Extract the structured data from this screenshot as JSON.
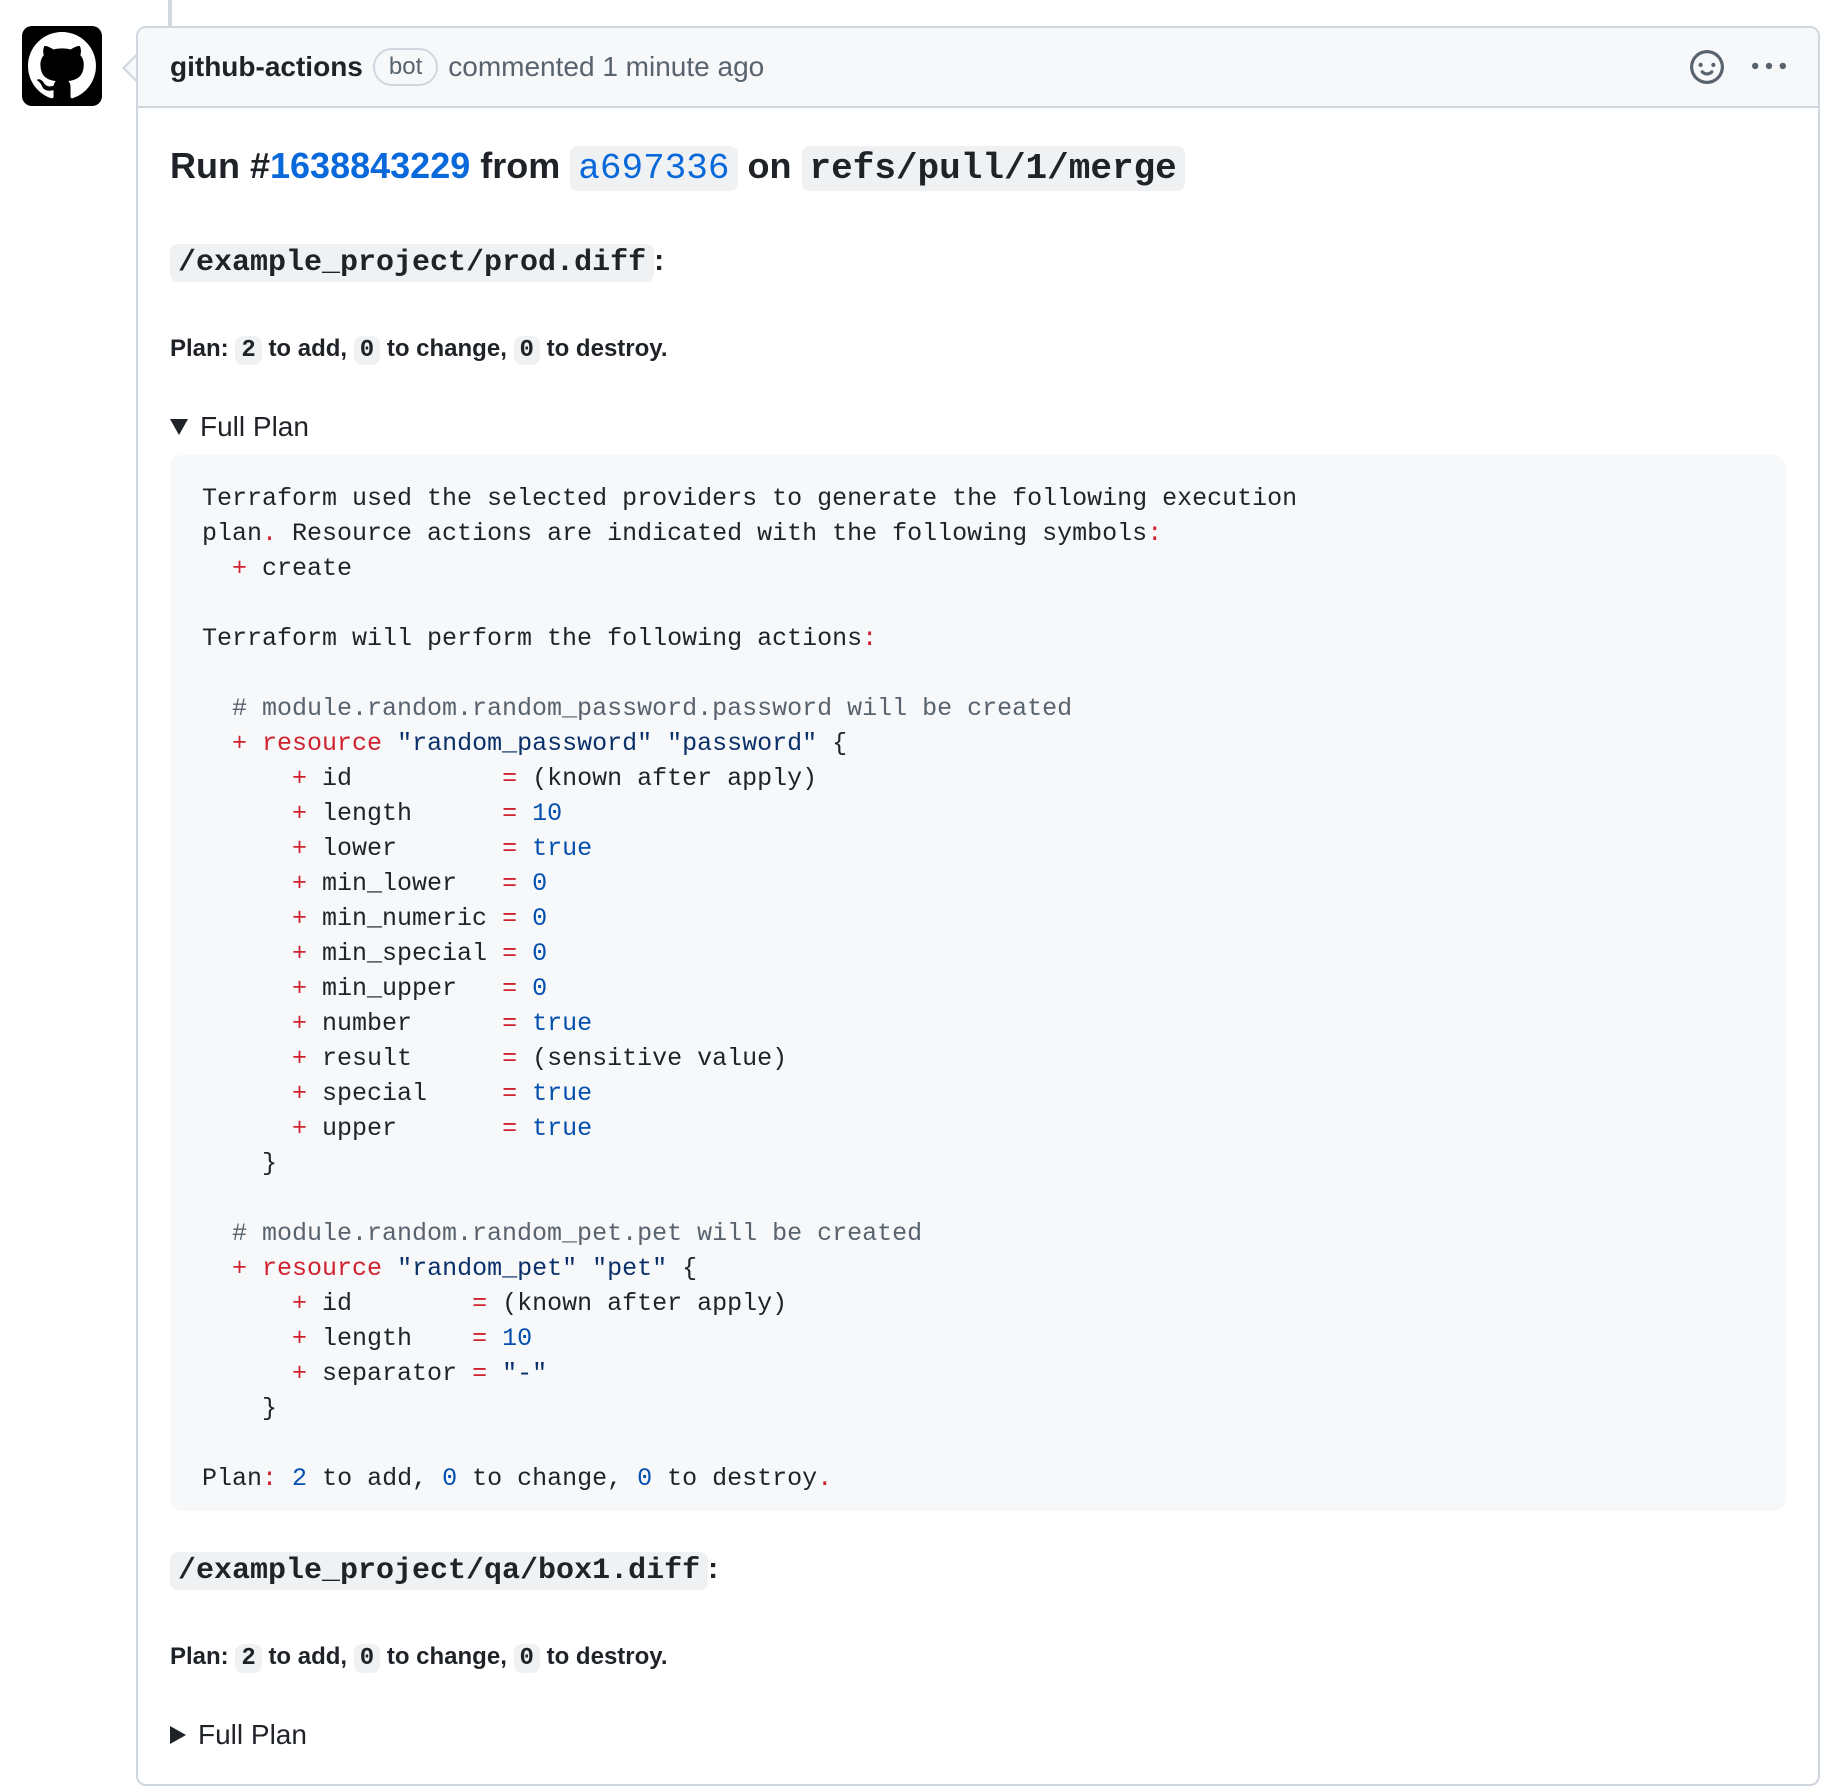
{
  "comment": {
    "author": "github-actions",
    "badge": "bot",
    "action": "commented 1 minute ago",
    "run": {
      "prefix": "Run #",
      "number": "1638843229",
      "from": "from",
      "commit": "a697336",
      "on": "on",
      "ref": "refs/pull/1/merge"
    },
    "sections": [
      {
        "file": "/example_project/prod.diff",
        "plan_prefix": "Plan:",
        "add": "2",
        "add_label": "to add,",
        "change": "0",
        "change_label": "to change,",
        "destroy": "0",
        "destroy_label": "to destroy.",
        "details_label": "Full Plan",
        "expanded": true
      },
      {
        "file": "/example_project/qa/box1.diff",
        "plan_prefix": "Plan:",
        "add": "2",
        "add_label": "to add,",
        "change": "0",
        "change_label": "to change,",
        "destroy": "0",
        "destroy_label": "to destroy.",
        "details_label": "Full Plan",
        "expanded": false
      }
    ],
    "plan_lines": [
      [
        {
          "t": "Terraform used the selected providers to generate the following execution"
        }
      ],
      [
        {
          "t": "plan"
        },
        {
          "t": ".",
          "c": "red"
        },
        {
          "t": " Resource actions are indicated with the following symbols"
        },
        {
          "t": ":",
          "c": "red"
        }
      ],
      [
        {
          "t": "  "
        },
        {
          "t": "+",
          "c": "red"
        },
        {
          "t": " create"
        }
      ],
      [],
      [
        {
          "t": "Terraform will perform the following actions"
        },
        {
          "t": ":",
          "c": "red"
        }
      ],
      [],
      [
        {
          "t": "  # module.random.random_password.password will be created",
          "c": "gray"
        }
      ],
      [
        {
          "t": "  "
        },
        {
          "t": "+ resource",
          "c": "red"
        },
        {
          "t": " "
        },
        {
          "t": "\"random_password\"",
          "c": "navy"
        },
        {
          "t": " "
        },
        {
          "t": "\"password\"",
          "c": "navy"
        },
        {
          "t": " {"
        }
      ],
      [
        {
          "t": "      "
        },
        {
          "t": "+",
          "c": "red"
        },
        {
          "t": " id          "
        },
        {
          "t": "=",
          "c": "red"
        },
        {
          "t": " (known after apply)"
        }
      ],
      [
        {
          "t": "      "
        },
        {
          "t": "+",
          "c": "red"
        },
        {
          "t": " length      "
        },
        {
          "t": "=",
          "c": "red"
        },
        {
          "t": " "
        },
        {
          "t": "10",
          "c": "blue"
        }
      ],
      [
        {
          "t": "      "
        },
        {
          "t": "+",
          "c": "red"
        },
        {
          "t": " lower       "
        },
        {
          "t": "=",
          "c": "red"
        },
        {
          "t": " "
        },
        {
          "t": "true",
          "c": "blue"
        }
      ],
      [
        {
          "t": "      "
        },
        {
          "t": "+",
          "c": "red"
        },
        {
          "t": " min_lower   "
        },
        {
          "t": "=",
          "c": "red"
        },
        {
          "t": " "
        },
        {
          "t": "0",
          "c": "blue"
        }
      ],
      [
        {
          "t": "      "
        },
        {
          "t": "+",
          "c": "red"
        },
        {
          "t": " min_numeric "
        },
        {
          "t": "=",
          "c": "red"
        },
        {
          "t": " "
        },
        {
          "t": "0",
          "c": "blue"
        }
      ],
      [
        {
          "t": "      "
        },
        {
          "t": "+",
          "c": "red"
        },
        {
          "t": " min_special "
        },
        {
          "t": "=",
          "c": "red"
        },
        {
          "t": " "
        },
        {
          "t": "0",
          "c": "blue"
        }
      ],
      [
        {
          "t": "      "
        },
        {
          "t": "+",
          "c": "red"
        },
        {
          "t": " min_upper   "
        },
        {
          "t": "=",
          "c": "red"
        },
        {
          "t": " "
        },
        {
          "t": "0",
          "c": "blue"
        }
      ],
      [
        {
          "t": "      "
        },
        {
          "t": "+",
          "c": "red"
        },
        {
          "t": " number      "
        },
        {
          "t": "=",
          "c": "red"
        },
        {
          "t": " "
        },
        {
          "t": "true",
          "c": "blue"
        }
      ],
      [
        {
          "t": "      "
        },
        {
          "t": "+",
          "c": "red"
        },
        {
          "t": " result      "
        },
        {
          "t": "=",
          "c": "red"
        },
        {
          "t": " (sensitive value)"
        }
      ],
      [
        {
          "t": "      "
        },
        {
          "t": "+",
          "c": "red"
        },
        {
          "t": " special     "
        },
        {
          "t": "=",
          "c": "red"
        },
        {
          "t": " "
        },
        {
          "t": "true",
          "c": "blue"
        }
      ],
      [
        {
          "t": "      "
        },
        {
          "t": "+",
          "c": "red"
        },
        {
          "t": " upper       "
        },
        {
          "t": "=",
          "c": "red"
        },
        {
          "t": " "
        },
        {
          "t": "true",
          "c": "blue"
        }
      ],
      [
        {
          "t": "    }"
        }
      ],
      [],
      [
        {
          "t": "  # module.random.random_pet.pet will be created",
          "c": "gray"
        }
      ],
      [
        {
          "t": "  "
        },
        {
          "t": "+ resource",
          "c": "red"
        },
        {
          "t": " "
        },
        {
          "t": "\"random_pet\"",
          "c": "navy"
        },
        {
          "t": " "
        },
        {
          "t": "\"pet\"",
          "c": "navy"
        },
        {
          "t": " {"
        }
      ],
      [
        {
          "t": "      "
        },
        {
          "t": "+",
          "c": "red"
        },
        {
          "t": " id        "
        },
        {
          "t": "=",
          "c": "red"
        },
        {
          "t": " (known after apply)"
        }
      ],
      [
        {
          "t": "      "
        },
        {
          "t": "+",
          "c": "red"
        },
        {
          "t": " length    "
        },
        {
          "t": "=",
          "c": "red"
        },
        {
          "t": " "
        },
        {
          "t": "10",
          "c": "blue"
        }
      ],
      [
        {
          "t": "      "
        },
        {
          "t": "+",
          "c": "red"
        },
        {
          "t": " separator "
        },
        {
          "t": "=",
          "c": "red"
        },
        {
          "t": " "
        },
        {
          "t": "\"-\"",
          "c": "navy"
        }
      ],
      [
        {
          "t": "    }"
        }
      ],
      [],
      [
        {
          "t": "Plan"
        },
        {
          "t": ":",
          "c": "red"
        },
        {
          "t": " "
        },
        {
          "t": "2",
          "c": "blue"
        },
        {
          "t": " to add, "
        },
        {
          "t": "0",
          "c": "blue"
        },
        {
          "t": " to change, "
        },
        {
          "t": "0",
          "c": "blue"
        },
        {
          "t": " to destroy"
        },
        {
          "t": ".",
          "c": "red"
        }
      ]
    ]
  },
  "icons": {
    "avatar": "github-octocat-icon",
    "reaction": "smiley-icon",
    "menu": "kebab-menu-icon",
    "expanded": "triangle-down-icon",
    "collapsed": "triangle-right-icon"
  },
  "colors": {
    "link": "#0969da",
    "keyword_red": "#cf222e",
    "number_blue": "#0550ae",
    "string_navy": "#0a3069",
    "comment_gray": "#59636e",
    "header_bg": "#f6f8fa",
    "border": "#d0d7de"
  }
}
